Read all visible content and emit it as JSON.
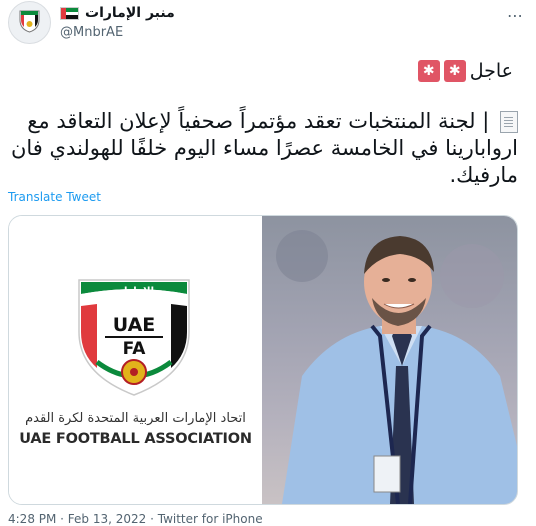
{
  "account": {
    "name": "منبر الإمارات",
    "handle": "@MnbrAE",
    "flag_icon": "uae-flag-icon"
  },
  "tweet": {
    "urgent_label": "عاجل",
    "text": "| لجنة المنتخبات تعقد مؤتمراً صحفياً لإعلان التعاقد مع اروابارينا في الخامسة عصرًا مساء اليوم خلفًا للهولندي فان مارفيك.",
    "translate_label": "Translate Tweet",
    "footer_partial": "4:28 PM · Feb 13, 2022 · Twitter for iPhone"
  },
  "media": {
    "logo_top_ar": "الإمارات",
    "logo_uae": "UAE",
    "logo_fa": "FA",
    "logo_ar_name": "اتحاد الإمارات العربية المتحدة لكرة القدم",
    "logo_en_name": "UAE FOOTBALL ASSOCIATION"
  },
  "colors": {
    "uae_green": "#0b8a3c",
    "uae_red": "#e03a3e",
    "link_blue": "#1d9bf0",
    "siren_red": "#e05565"
  }
}
